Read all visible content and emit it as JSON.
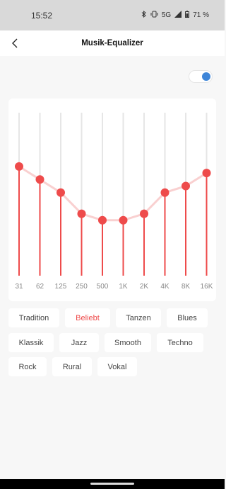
{
  "status_bar": {
    "time": "15:52",
    "network": "5G",
    "battery": "71 %"
  },
  "header": {
    "title": "Musik-Equalizer"
  },
  "toggle": {
    "on": true,
    "color": "#3d85d8"
  },
  "equalizer": {
    "accent": "#ee4b4b",
    "track_color": "#e6e6e6",
    "line_color": "#f9d0d0",
    "bands": [
      {
        "label": "31",
        "level": 0.67
      },
      {
        "label": "62",
        "level": 0.59
      },
      {
        "label": "125",
        "level": 0.51
      },
      {
        "label": "250",
        "level": 0.38
      },
      {
        "label": "500",
        "level": 0.34
      },
      {
        "label": "1K",
        "level": 0.34
      },
      {
        "label": "2K",
        "level": 0.38
      },
      {
        "label": "4K",
        "level": 0.51
      },
      {
        "label": "8K",
        "level": 0.55
      },
      {
        "label": "16K",
        "level": 0.63
      }
    ]
  },
  "presets": [
    {
      "label": "Tradition",
      "active": false
    },
    {
      "label": "Beliebt",
      "active": true
    },
    {
      "label": "Tanzen",
      "active": false
    },
    {
      "label": "Blues",
      "active": false
    },
    {
      "label": "Klassik",
      "active": false
    },
    {
      "label": "Jazz",
      "active": false
    },
    {
      "label": "Smooth",
      "active": false
    },
    {
      "label": "Techno",
      "active": false
    },
    {
      "label": "Rock",
      "active": false
    },
    {
      "label": "Rural",
      "active": false
    },
    {
      "label": "Vokal",
      "active": false
    }
  ]
}
